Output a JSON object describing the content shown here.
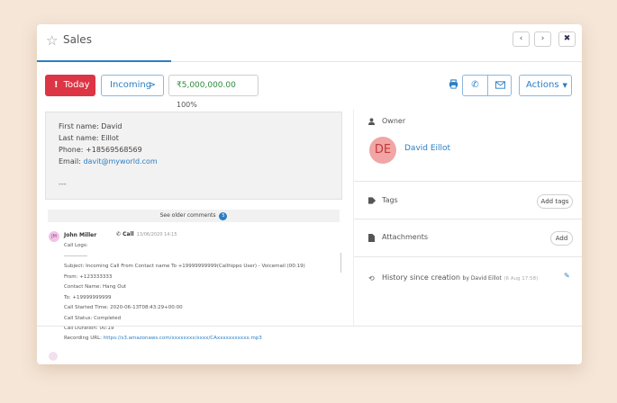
{
  "window": {
    "title": "Sales",
    "nav_prev": "‹",
    "nav_next": "›",
    "close": "✖"
  },
  "toolbar": {
    "today_label": "Today",
    "incoming_label": "Incoming",
    "amount": "₹5,000,000.00",
    "amount_percent": "100%",
    "actions_label": "Actions"
  },
  "contact": {
    "first_name": "First name: David",
    "last_name": "Last name: Eillot",
    "phone": "Phone: +18569568569",
    "email_label": "Email: ",
    "email": "davit@myworld.com",
    "dashes": "---"
  },
  "comments": {
    "see_older": "See older comments",
    "older_count": "5"
  },
  "log": {
    "author_initials": "JM",
    "author": "John Miller",
    "type": "Call",
    "date": "13/06/2020 14:15",
    "lines": [
      "Call Logs:",
      "-------------",
      "Subject: Incoming Call From Contact name To +19999999999(Callhippo User) - Voicemail (00:19)",
      "From: +123333333",
      "Contact Name: Hang Out",
      "To: +19999999999",
      "Call Started Time: 2020-06-13T08:43:29+00:00",
      "Call Status: Completed",
      "Call Duration: 00:19"
    ],
    "recording_label": "Recording URL: ",
    "recording_url": "https://s3.amazonaws.com/xxxxxxxx/xxxx/CAxxxxxxxxxxx.mp3"
  },
  "sidebar": {
    "owner_label": "Owner",
    "owner_initials": "DE",
    "owner_name": "David Eillot",
    "tags_label": "Tags",
    "add_tags": "Add tags",
    "attachments_label": "Attachments",
    "add_attachment": "Add",
    "history_label": "History since creation",
    "history_by": "by David Eillot",
    "history_date": "(6 Aug 17:58)"
  },
  "colors": {
    "accent": "#2a7ec4",
    "danger": "#dc3545",
    "amount_green": "#2e8b3a"
  },
  "icons": [
    "star-icon",
    "print-icon",
    "phone-icon",
    "mail-icon",
    "user-icon",
    "tag-icon",
    "file-icon",
    "history-icon",
    "edit-icon"
  ]
}
